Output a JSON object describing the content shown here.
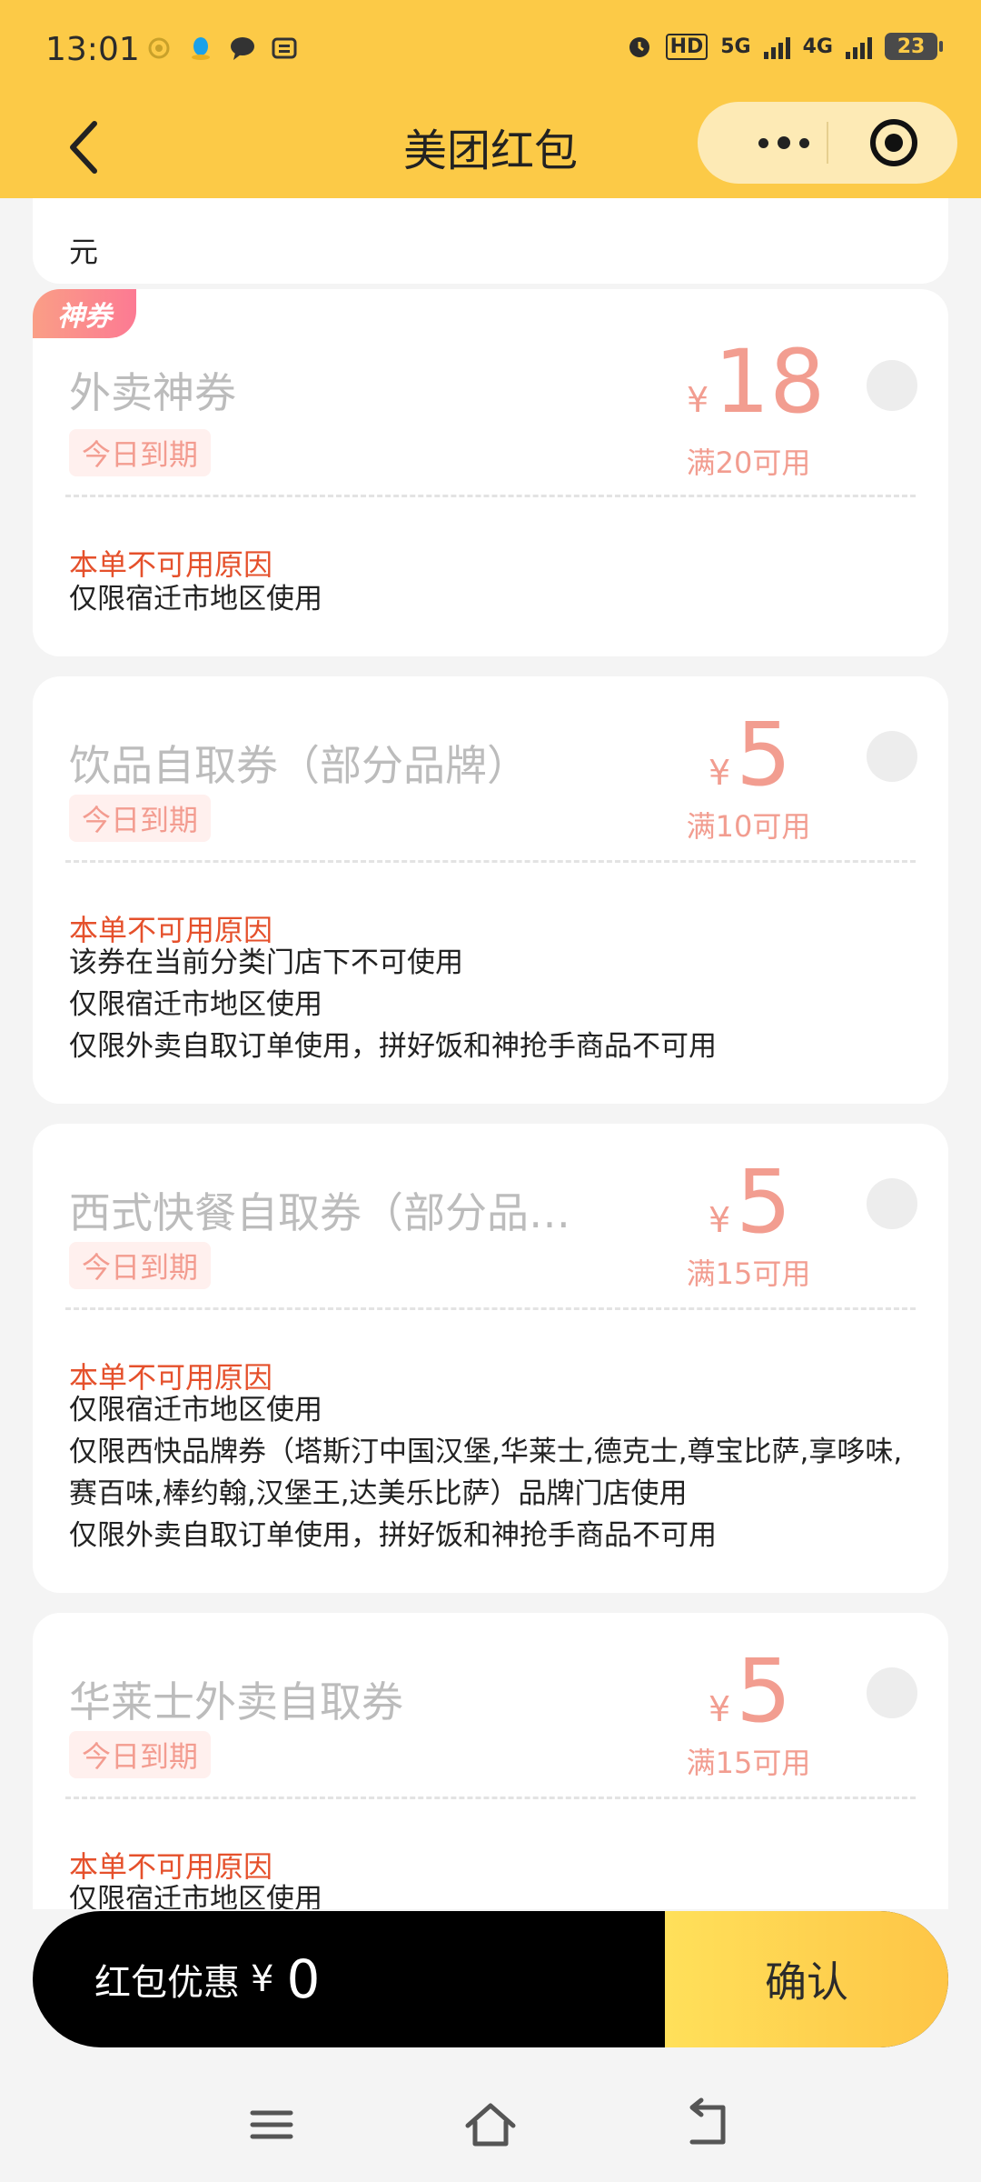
{
  "status_bar": {
    "time": "13:01",
    "network_hd": "HD",
    "network_5g": "5G",
    "network_4g": "4G",
    "battery": "23"
  },
  "header": {
    "title": "美团红包"
  },
  "previous_card": {
    "tail_text": "元"
  },
  "coupons": [
    {
      "tag": "神券",
      "title": "外卖神券",
      "expire": "今日到期",
      "currency": "¥",
      "amount": "18",
      "condition": "满20可用",
      "reason_title": "本单不可用原因",
      "reasons": [
        "仅限宿迁市地区使用"
      ]
    },
    {
      "title": "饮品自取券（部分品牌）",
      "expire": "今日到期",
      "currency": "¥",
      "amount": "5",
      "condition": "满10可用",
      "reason_title": "本单不可用原因",
      "reasons": [
        "该券在当前分类门店下不可使用",
        "仅限宿迁市地区使用",
        "仅限外卖自取订单使用，拼好饭和神抢手商品不可用"
      ]
    },
    {
      "title": "西式快餐自取券（部分品…",
      "expire": "今日到期",
      "currency": "¥",
      "amount": "5",
      "condition": "满15可用",
      "reason_title": "本单不可用原因",
      "reasons": [
        "仅限宿迁市地区使用",
        "仅限西快品牌券（塔斯汀中国汉堡,华莱士,德克士,尊宝比萨,享哆味,赛百味,棒约翰,汉堡王,达美乐比萨）品牌门店使用",
        "仅限外卖自取订单使用，拼好饭和神抢手商品不可用"
      ]
    },
    {
      "title": "华莱士外卖自取券",
      "expire": "今日到期",
      "currency": "¥",
      "amount": "5",
      "condition": "满15可用",
      "reason_title": "本单不可用原因",
      "reasons": [
        "仅限宿迁市地区使用"
      ]
    }
  ],
  "bottom_bar": {
    "label": "红包优惠",
    "currency": "¥",
    "amount": "0",
    "confirm": "确认"
  }
}
